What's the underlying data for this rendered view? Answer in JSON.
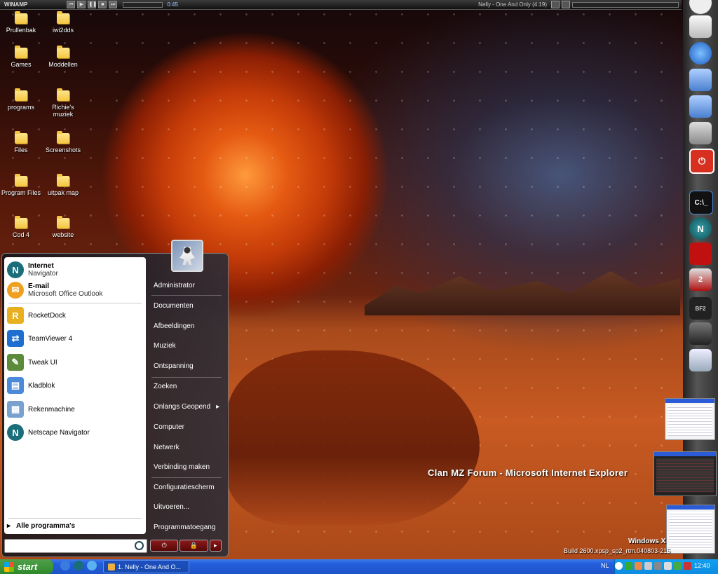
{
  "winamp": {
    "logo": "WINAMP",
    "time": "0:45",
    "song": "Nelly - One And Only (4:19)"
  },
  "desktop": {
    "icons": [
      {
        "label": "Prullenbak"
      },
      {
        "label": "iwi2dds"
      },
      {
        "label": "Games"
      },
      {
        "label": "Moddellen"
      },
      {
        "label": "programs"
      },
      {
        "label": "Richie's muziek"
      },
      {
        "label": "Files"
      },
      {
        "label": "Screenshots"
      },
      {
        "label": "Program Files"
      },
      {
        "label": "uitpak map"
      },
      {
        "label": "Cod 4"
      },
      {
        "label": "website"
      }
    ],
    "ie_window_title": "Clan MZ Forum - Microsoft Internet Explorer",
    "watermark": {
      "os": "Windows X",
      "build": "Build 2600.xpsp_sp2_rtm.040803-215"
    }
  },
  "start_menu": {
    "pinned": [
      {
        "title": "Internet",
        "subtitle": "Navigator",
        "icon": "netscape-icon",
        "color": "#1a6e7a"
      },
      {
        "title": "E-mail",
        "subtitle": "Microsoft Office Outlook",
        "icon": "outlook-icon",
        "color": "#f0a020"
      }
    ],
    "recent": [
      {
        "label": "RocketDock",
        "icon": "rocketdock-icon",
        "color": "#e8b020",
        "glyph": "R"
      },
      {
        "label": "TeamViewer 4",
        "icon": "teamviewer-icon",
        "color": "#1e6fd0",
        "glyph": "⇄"
      },
      {
        "label": "Tweak UI",
        "icon": "tweakui-icon",
        "color": "#5a8a3a",
        "glyph": "✎"
      },
      {
        "label": "Kladblok",
        "icon": "notepad-icon",
        "color": "#4a8ad8",
        "glyph": "▤"
      },
      {
        "label": "Rekenmachine",
        "icon": "calculator-icon",
        "color": "#7aa0d0",
        "glyph": "▦"
      },
      {
        "label": "Netscape Navigator",
        "icon": "netscape-icon",
        "color": "#1a6e7a",
        "glyph": "N"
      }
    ],
    "all_programs": "Alle programma's",
    "right": [
      "Administrator",
      "Documenten",
      "Afbeeldingen",
      "Muziek",
      "Ontspanning",
      "Zoeken",
      "Onlangs Geopend",
      "Computer",
      "Netwerk",
      "Verbinding maken",
      "Configuratiescherm",
      "Uitvoeren...",
      "Programmatoegang"
    ],
    "submenu_arrow": "▸"
  },
  "taskbar": {
    "start_label": "start",
    "task_label": "1. Nelly - One And O...",
    "language": "NL",
    "clock": "12:40"
  },
  "colors": {
    "taskbar": "#245edb",
    "start_green": "#2f8a2b",
    "tray": "#0d8ce0"
  }
}
